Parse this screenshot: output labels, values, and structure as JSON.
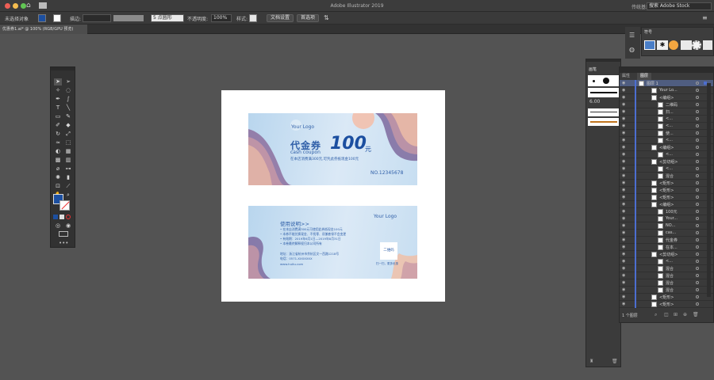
{
  "app": {
    "title": "Adobe Illustrator 2019"
  },
  "controlbar": {
    "no_selection": "未选择对象",
    "stroke_label": "描边:",
    "brush_size": "5 点圆形",
    "opacity_label": "不透明度:",
    "opacity_value": "100%",
    "style_label": "样式:",
    "doc_settings": "文档设置",
    "preferences": "首选项",
    "workspace": "传统基本功能",
    "search_placeholder": "搜索 Adobe Stock"
  },
  "document_tab": {
    "label": "优惠券1.ai* @ 100% (RGB/GPU 预览)"
  },
  "coupon_front": {
    "logo": "Your Logo",
    "title": "代金券",
    "amount": "100",
    "unit": "元",
    "subtitle": "cash coupon",
    "condition": "在本店消费满300元,可凭此券抵现金100元",
    "serial": "NO.12345678"
  },
  "coupon_back": {
    "logo": "Your Logo",
    "heading": "使用说明>>",
    "rules": [
      "• 在本店消费满300元可使用此券抵现金100元",
      "• 本券不能兑换现金、不找零、须兼套餐不会变更",
      "• 有效期：2019年6月1日—2019年8月31日",
      "• 本卷最终解释权归本公司所有"
    ],
    "address": "地址：浙江省杭州市余杭区文一西路1218号",
    "phone": "电话：0571-XXXXXXX",
    "website": "www.huitu.com",
    "qr_label": "二维码",
    "qr_caption": "扫一扫，更多优惠"
  },
  "brush_panel": {
    "title": "画笔",
    "brush_size": "6.00"
  },
  "swatch_panel": {
    "title": "符号"
  },
  "layers_panel": {
    "tab_properties": "属性",
    "tab_layers": "图层",
    "footer": "1 个图层",
    "rows": [
      {
        "label": "图层 1",
        "level": 0
      },
      {
        "label": "Your Lo...",
        "level": 2
      },
      {
        "label": "<编组>",
        "level": 2
      },
      {
        "label": "二维码",
        "level": 3
      },
      {
        "label": "扫...",
        "level": 3
      },
      {
        "label": "<...",
        "level": 3
      },
      {
        "label": "<...",
        "level": 3
      },
      {
        "label": "使...",
        "level": 3
      },
      {
        "label": "<...",
        "level": 3
      },
      {
        "label": "<编组>",
        "level": 2
      },
      {
        "label": "<...",
        "level": 3
      },
      {
        "label": "<剪切组>",
        "level": 2
      },
      {
        "label": "<...",
        "level": 3
      },
      {
        "label": "混合",
        "level": 3
      },
      {
        "label": "<矩形>",
        "level": 2
      },
      {
        "label": "<矩形>",
        "level": 2
      },
      {
        "label": "<矩形>",
        "level": 2
      },
      {
        "label": "<编组>",
        "level": 2
      },
      {
        "label": "100元",
        "level": 3
      },
      {
        "label": "Your...",
        "level": 3
      },
      {
        "label": "NO...",
        "level": 3
      },
      {
        "label": "cas...",
        "level": 3
      },
      {
        "label": "代金券",
        "level": 3
      },
      {
        "label": "在本...",
        "level": 3
      },
      {
        "label": "<剪切组>",
        "level": 2
      },
      {
        "label": "<...",
        "level": 3
      },
      {
        "label": "混合",
        "level": 3
      },
      {
        "label": "混合",
        "level": 3
      },
      {
        "label": "混合",
        "level": 3
      },
      {
        "label": "混合",
        "level": 3
      },
      {
        "label": "<矩形>",
        "level": 2
      },
      {
        "label": "<矩形>",
        "level": 2
      }
    ]
  },
  "colors": {
    "accent": "#4c6ed0",
    "fill": "#1c4fa0",
    "coupon_blue": "#2f5fa8"
  }
}
